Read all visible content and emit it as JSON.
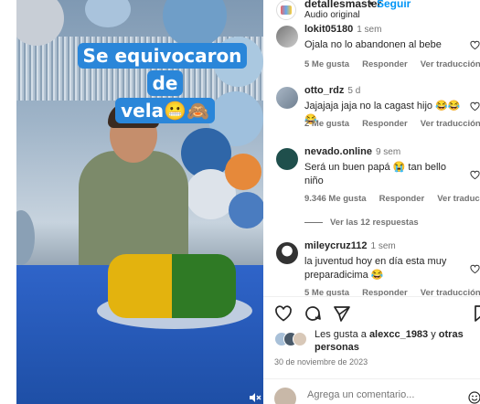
{
  "video": {
    "overlay_line1": "Se equivocaron de",
    "overlay_line2": "vela😬🙈",
    "mute_icon": "speaker-muted-icon"
  },
  "post": {
    "username": "detallesmaster",
    "separator": "•",
    "follow_label": "Seguir",
    "audio_label": "Audio original"
  },
  "comments": [
    {
      "user": "lokit05180",
      "time": "1 sem",
      "text": "Ojala no lo abandonen al bebe",
      "likes": "5 Me gusta",
      "reply": "Responder",
      "translate": "Ver traducción"
    },
    {
      "user": "otto_rdz",
      "time": "5 d",
      "text": "Jajajaja jaja no la cagast hijo 😂😂😂",
      "likes": "2 Me gusta",
      "reply": "Responder",
      "translate": "Ver traducción"
    },
    {
      "user": "nevado.online",
      "time": "9 sem",
      "text": "Será un buen papá 😭 tan bello niño",
      "likes": "9.346 Me gusta",
      "reply": "Responder",
      "translate": "Ver traducción",
      "view_replies": "Ver las 12 respuestas"
    },
    {
      "user": "mileycruz112",
      "time": "1 sem",
      "text": "la juventud hoy en día esta muy preparadicima 😂",
      "likes": "5 Me gusta",
      "reply": "Responder",
      "translate": "Ver traducción"
    }
  ],
  "actions": {
    "like_icon": "heart-icon",
    "comment_icon": "comment-icon",
    "share_icon": "share-icon",
    "save_icon": "bookmark-icon"
  },
  "likes_summary": {
    "prefix": "Les gusta a ",
    "user": "alexcc_1983",
    "middle": " y ",
    "others": "otras personas"
  },
  "date": "30 de noviembre de 2023",
  "add_comment": {
    "placeholder": "Agrega un comentario...",
    "emoji_icon": "emoji-icon"
  },
  "colors": {
    "accent": "#0095f6",
    "overlay_bg": "#2a86d9",
    "muted_text": "#737373"
  }
}
